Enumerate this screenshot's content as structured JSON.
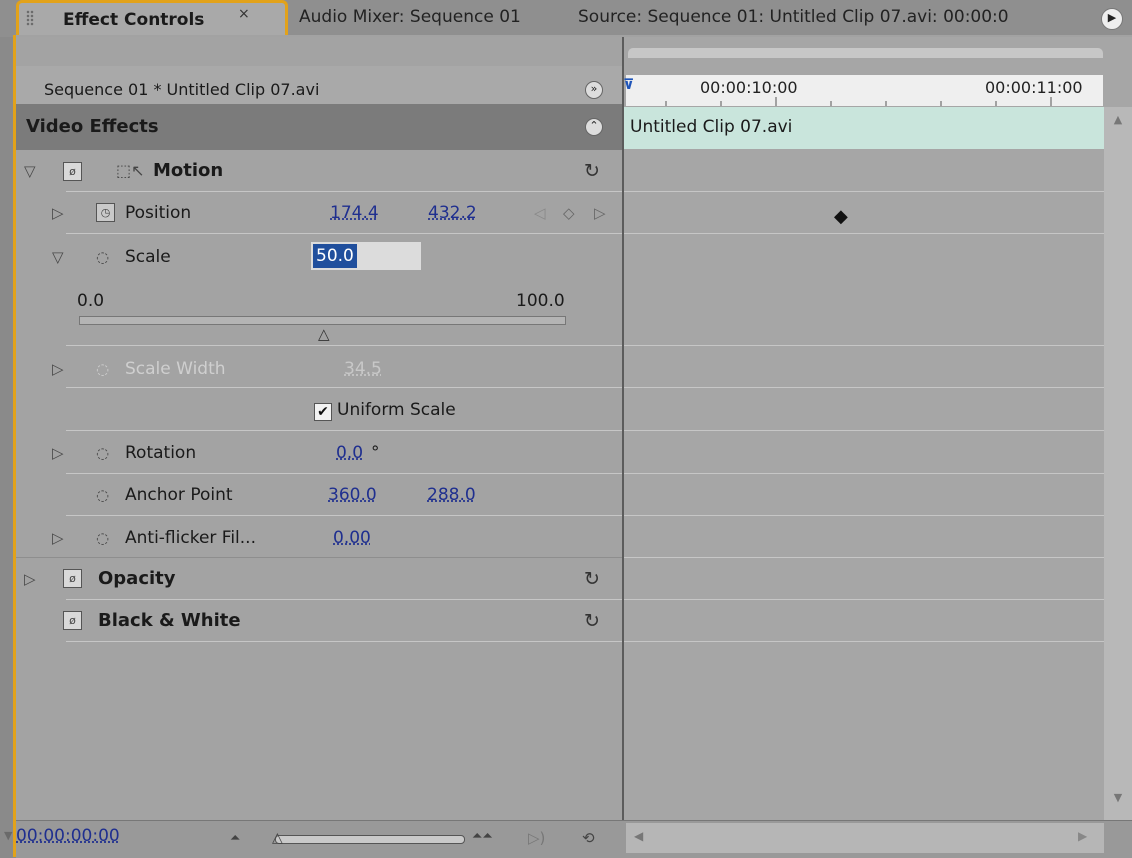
{
  "tabs": {
    "active_label": "Effect Controls",
    "close_glyph": "×",
    "audio_mixer": "Audio Mixer: Sequence 01",
    "source": "Source: Sequence 01: Untitled Clip 07.avi: 00:00:0"
  },
  "header": {
    "sequence_clip": "Sequence 01 * Untitled Clip 07.avi"
  },
  "video_effects": {
    "label": "Video Effects"
  },
  "motion": {
    "label": "Motion",
    "position": {
      "label": "Position",
      "x": "174.4",
      "y": "432.2"
    },
    "scale": {
      "label": "Scale",
      "value": "50.0",
      "slider_min": "0.0",
      "slider_max": "100.0",
      "slider_value": 50
    },
    "scale_width": {
      "label": "Scale Width",
      "value": "34.5"
    },
    "uniform_scale": {
      "label": "Uniform Scale",
      "checked": true
    },
    "rotation": {
      "label": "Rotation",
      "value": "0.0",
      "unit": "°"
    },
    "anchor_point": {
      "label": "Anchor Point",
      "x": "360.0",
      "y": "288.0"
    },
    "anti_flicker": {
      "label": "Anti-flicker Fil...",
      "value": "0.00"
    }
  },
  "opacity": {
    "label": "Opacity"
  },
  "black_white": {
    "label": "Black & White"
  },
  "timeline": {
    "tc1": "00:00:10:00",
    "tc2": "00:00:11:00",
    "clip_name": "Untitled Clip 07.avi"
  },
  "bottom": {
    "timecode": "00:00:00:00"
  },
  "colors": {
    "accent_border": "#e2a21a",
    "clip_bar": "#c9e5dc",
    "value_link": "#1f2f8f",
    "selection": "#204f9d"
  },
  "icons": [
    "panel-menu-icon",
    "stopwatch-icon",
    "reset-icon",
    "keyframe-icon",
    "fx-toggle-icon",
    "motion-icon",
    "checkbox-check-icon"
  ]
}
